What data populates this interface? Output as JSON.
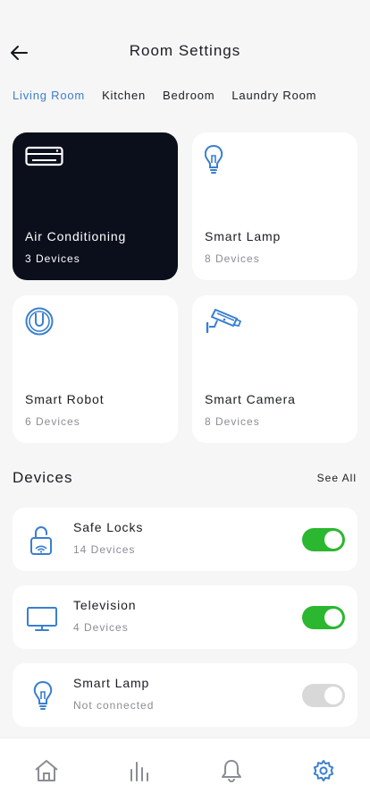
{
  "header": {
    "title": "Room Settings",
    "back_icon": "arrow-left-icon"
  },
  "tabs": [
    {
      "label": "Living Room",
      "active": true
    },
    {
      "label": "Kitchen",
      "active": false
    },
    {
      "label": "Bedroom",
      "active": false
    },
    {
      "label": "Laundry Room",
      "active": false
    }
  ],
  "categories": [
    {
      "name": "Air Conditioning",
      "count": "3 Devices",
      "icon": "air-conditioner-icon",
      "selected": true
    },
    {
      "name": "Smart Lamp",
      "count": "8 Devices",
      "icon": "lightbulb-icon",
      "selected": false
    },
    {
      "name": "Smart Robot",
      "count": "6 Devices",
      "icon": "robot-vacuum-icon",
      "selected": false
    },
    {
      "name": "Smart Camera",
      "count": "8 Devices",
      "icon": "security-camera-icon",
      "selected": false
    }
  ],
  "devices_section": {
    "title": "Devices",
    "see_all": "See All"
  },
  "devices": [
    {
      "name": "Safe Locks",
      "sub": "14 Devices",
      "icon": "smart-lock-icon",
      "on": true
    },
    {
      "name": "Television",
      "sub": "4 Devices",
      "icon": "television-icon",
      "on": true
    },
    {
      "name": "Smart Lamp",
      "sub": "Not connected",
      "icon": "lightbulb-icon",
      "on": false
    }
  ],
  "bottom_nav": [
    {
      "icon": "home-icon",
      "active": false
    },
    {
      "icon": "stats-icon",
      "active": false
    },
    {
      "icon": "bell-icon",
      "active": false
    },
    {
      "icon": "settings-icon",
      "active": true
    }
  ],
  "colors": {
    "accent": "#3a7fd0",
    "dark_card": "#0b0f1c",
    "toggle_on": "#2bb72f",
    "toggle_off": "#d8d8d8",
    "nav_inactive": "#8a8d94",
    "nav_active": "#3a7fd0"
  }
}
